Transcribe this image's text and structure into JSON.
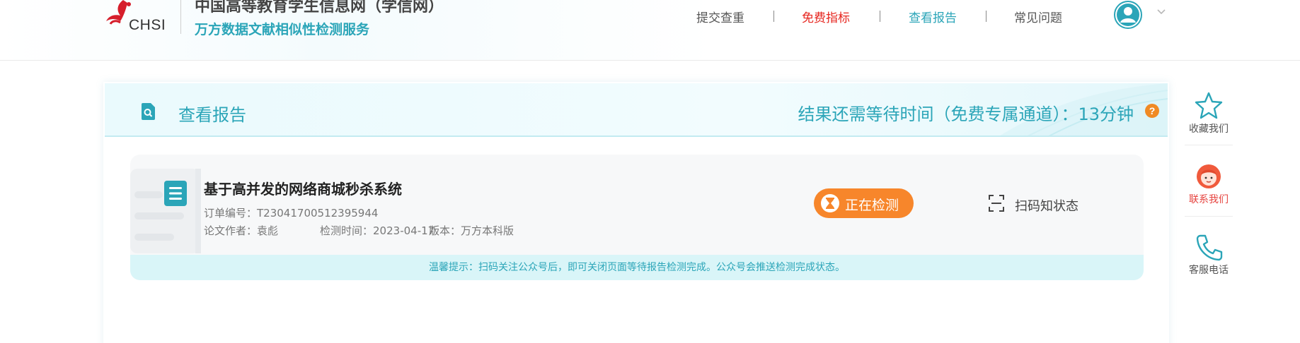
{
  "header": {
    "logo_text": "CHSI",
    "site_title": "中国高等教育学生信息网（学信网）",
    "site_subtitle": "万方数据文献相似性检测服务",
    "nav": [
      {
        "label": "提交查重",
        "color": "#555555"
      },
      {
        "label": "免费指标",
        "color": "#e6261f"
      },
      {
        "label": "查看报告",
        "color": "#2ba5b8"
      },
      {
        "label": "常见问题",
        "color": "#555555"
      }
    ],
    "avatar_icon": "user-avatar-icon"
  },
  "card": {
    "title": "查看报告",
    "wait_text": "结果还需等待时间（免费专属通道）：13分钟",
    "help_glyph": "?"
  },
  "item": {
    "title": "基于高并发的网络商城秒杀系统",
    "order_label": "订单编号：",
    "order_no": "T23041700512395944",
    "author_label": "论文作者：",
    "author": "袁彪",
    "time_label": "检测时间：",
    "time": "2023-04-17",
    "version_label": "版本：",
    "version": "万方本科版",
    "status": "正在检测",
    "scan_label": "扫码知状态",
    "tip": "温馨提示：扫码关注公众号后，即可关闭页面等待报告检测完成。公众号会推送检测完成状态。"
  },
  "float": {
    "items": [
      {
        "label": "收藏我们",
        "icon": "star-icon"
      },
      {
        "label": "联系我们",
        "icon": "customer-service-icon"
      },
      {
        "label": "客服电话",
        "icon": "phone-icon"
      }
    ]
  },
  "colors": {
    "accent": "#2ba5b8",
    "status": "#f7862b",
    "alert": "#e6261f"
  }
}
